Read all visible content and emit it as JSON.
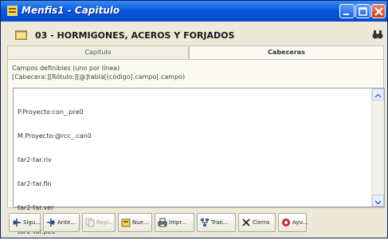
{
  "window": {
    "title": "Menfis1 - Capitulo",
    "titlebar_color": "#0a5ae0"
  },
  "header": {
    "title": "03 - HORMIGONES, ACEROS Y FORJADOS"
  },
  "tabs": [
    {
      "label": "Capitulo",
      "active": false
    },
    {
      "label": "Cabeceras",
      "active": true
    }
  ],
  "info": {
    "line1": "Campos definibles (uno por línea)",
    "line2": "[Cabecera:][Rótulo:][@]tabla[(código].campo[.campo)"
  },
  "editor": {
    "lines": [
      "P.Proyecto:con_.pre0",
      "M.Proyecto:@rcc_.can0",
      "tar2-tar.riv",
      "tar2-tar.fin",
      "tar2-tar.ver",
      "tar2-tar.peo"
    ]
  },
  "buttons": [
    {
      "label": "Sigu...",
      "icon": "arrow-right-icon",
      "enabled": true
    },
    {
      "label": "Ante...",
      "icon": "arrow-left-icon",
      "enabled": true
    },
    {
      "label": "Repl...",
      "icon": "copy-icon",
      "enabled": false
    },
    {
      "label": "Nue...",
      "icon": "new-icon",
      "enabled": true
    },
    {
      "label": "Impr...",
      "icon": "printer-icon",
      "enabled": true
    },
    {
      "label": "Trao...",
      "icon": "tree-icon",
      "enabled": true
    },
    {
      "label": "Cierra",
      "icon": "close-x-icon",
      "enabled": true
    },
    {
      "label": "Ayu...",
      "icon": "help-icon",
      "enabled": true
    }
  ]
}
